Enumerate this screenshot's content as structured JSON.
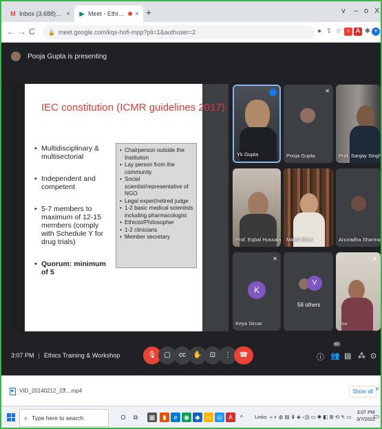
{
  "browser": {
    "tabs": [
      {
        "label": "Inbox (3,688) - drpopli@jmi.ac.in",
        "icon": "gmail-icon"
      },
      {
        "label": "Meet - Ethics Training & Wo",
        "icon": "meet-icon"
      }
    ],
    "new_tab": "+",
    "window_controls": [
      "v",
      "–",
      "o",
      "X"
    ],
    "url": "meet.google.com/kqx-hofi-mpp?pli=1&authuser=2"
  },
  "meet": {
    "presenting_text": "Pooja Gupta is presenting",
    "meeting_time": "3:07 PM",
    "meeting_name": "Ethics Training & Workshop",
    "slide": {
      "title": "IEC constitution (ICMR guidelines 2017)",
      "bullets": [
        "Multidisciplinary & multisectorial",
        "Independent and competent",
        "5-7 members to maximum of 12-15 members (comply with Schedule Y for drug trials)",
        "Quorum: minimum of 5"
      ],
      "box_items": [
        "Chairperson outside the Institution",
        "Lay person from the community",
        "Social scientist/representative of NGO",
        "Legal expert/retired judge",
        "1-2 basic medical scientists including pharmacologist",
        "Ethicist/Philosopher",
        "1-2 clinicians",
        "Member secretary"
      ]
    },
    "participants": [
      "Yk Gupta",
      "Pooja Gupta",
      "Prof. Sanjay Singh (...",
      "Prof. Eqbal Hussain ...",
      "Mahdi Rizvi",
      "Anuradha Sharma (P...",
      "Keya Sircar",
      "58 others",
      "You"
    ],
    "avatar_letters": {
      "keya": "K",
      "others": "V"
    },
    "participant_badge": "47"
  },
  "downloads": {
    "file_name": "VID_20140212_23....mp4",
    "show_all": "Show all"
  },
  "taskbar": {
    "search_placeholder": "Type here to search",
    "links_label": "Links",
    "time": "3:07 PM",
    "date": "3/7/2022"
  },
  "colors": {
    "meet_bg": "#202124",
    "tile_bg": "#3c4043",
    "hangup_red": "#ea4335",
    "slide_title_red": "#e53935",
    "accent_blue": "#1a73e8"
  }
}
